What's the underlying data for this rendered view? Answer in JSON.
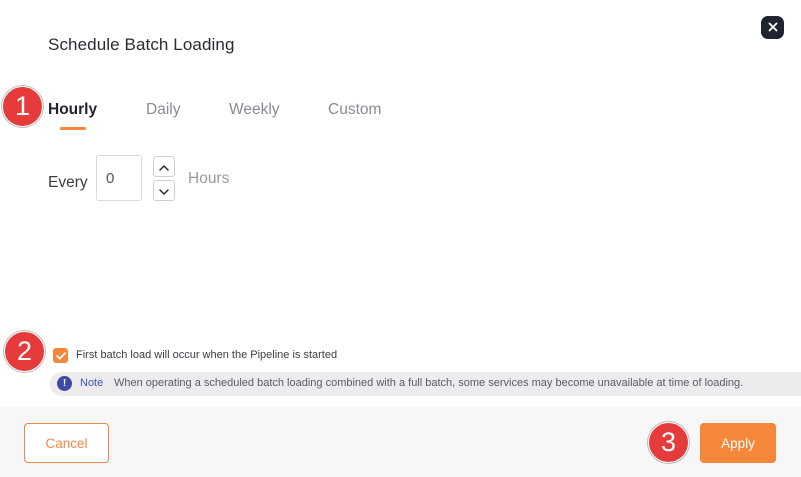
{
  "dialog": {
    "title": "Schedule Batch Loading",
    "close_icon": "close-icon"
  },
  "tabs": [
    {
      "label": "Hourly",
      "active": true
    },
    {
      "label": "Daily",
      "active": false
    },
    {
      "label": "Weekly",
      "active": false
    },
    {
      "label": "Custom",
      "active": false
    }
  ],
  "interval": {
    "prefix_label": "Every",
    "value": "0",
    "unit_label": "Hours",
    "increment_icon": "chevron-up-icon",
    "decrement_icon": "chevron-down-icon"
  },
  "first_load": {
    "checked": true,
    "label": "First batch load will occur when the Pipeline is started"
  },
  "note": {
    "icon": "exclamation-icon",
    "label": "Note",
    "text": "When operating a scheduled batch loading combined with a full batch, some services may become unavailable at time of loading."
  },
  "footer": {
    "cancel_label": "Cancel",
    "apply_label": "Apply"
  },
  "annotations": {
    "badge_1": "1",
    "badge_2": "2",
    "badge_3": "3"
  },
  "colors": {
    "accent": "#f5873a",
    "badge": "#e53b3b",
    "note_accent": "#4653b8"
  }
}
